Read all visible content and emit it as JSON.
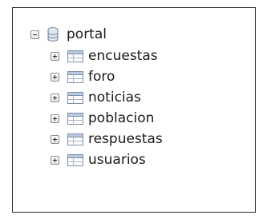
{
  "tree": {
    "root": {
      "label": "portal",
      "expanded": true,
      "icon": "database-icon"
    },
    "children": [
      {
        "label": "encuestas",
        "icon": "table-icon"
      },
      {
        "label": "foro",
        "icon": "table-icon"
      },
      {
        "label": "noticias",
        "icon": "table-icon"
      },
      {
        "label": "poblacion",
        "icon": "table-icon"
      },
      {
        "label": "respuestas",
        "icon": "table-icon"
      },
      {
        "label": "usuarios",
        "icon": "table-icon"
      }
    ]
  }
}
